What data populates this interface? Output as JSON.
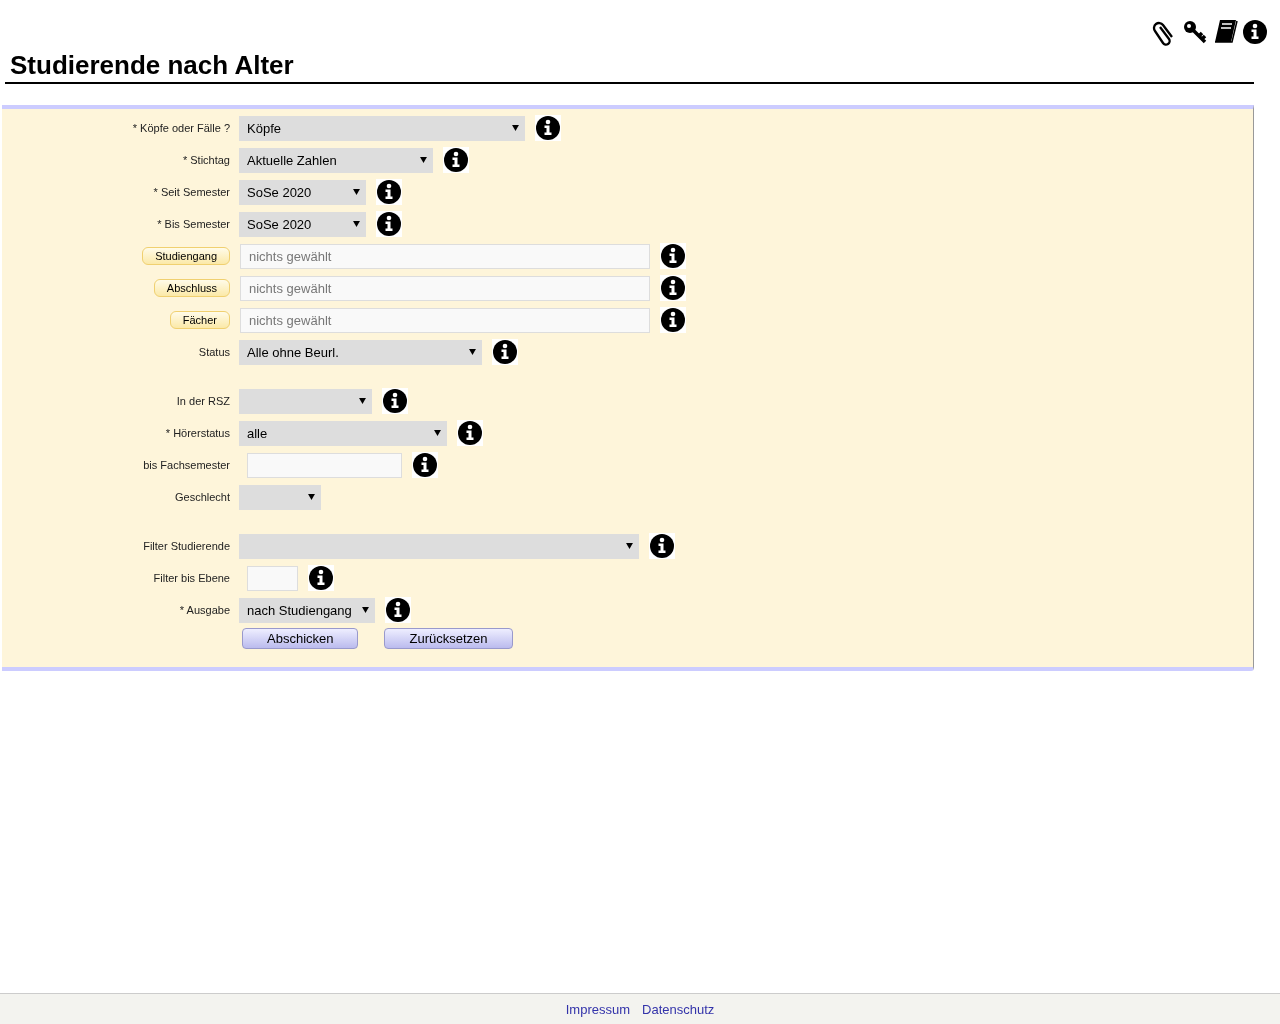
{
  "title": "Studierende nach Alter",
  "field_groups": [
    [
      {
        "kind": "select",
        "label": "* Köpfe oder Fälle ?",
        "value": "Köpfe",
        "info_icon": true
      },
      {
        "kind": "select",
        "label": "* Stichtag",
        "value": "Aktuelle Zahlen",
        "info_icon": true
      },
      {
        "kind": "select",
        "label": "* Seit Semester",
        "value": "SoSe 2020",
        "info_icon": true
      },
      {
        "kind": "select",
        "label": "* Bis Semester",
        "value": "SoSe 2020",
        "info_icon": true
      },
      {
        "kind": "picker",
        "label": "Studiengang",
        "placeholder": "nichts gewählt",
        "info_icon": true
      },
      {
        "kind": "picker",
        "label": "Abschluss",
        "placeholder": "nichts gewählt",
        "info_icon": true
      },
      {
        "kind": "picker",
        "label": "Fächer",
        "placeholder": "nichts gewählt",
        "info_icon": true
      },
      {
        "kind": "select",
        "label": "Status",
        "value": "Alle ohne Beurl.",
        "info_icon": true
      }
    ],
    [
      {
        "kind": "select",
        "label": "In der RSZ",
        "info_icon": true
      },
      {
        "kind": "select",
        "label": "* Hörerstatus",
        "value": "alle",
        "info_icon": true
      },
      {
        "kind": "input",
        "label": "bis Fachsemester",
        "info_icon": true
      },
      {
        "kind": "select",
        "label": "Geschlecht",
        "info_icon": false
      }
    ],
    [
      {
        "kind": "select",
        "label": "Filter Studierende",
        "info_icon": true
      },
      {
        "kind": "input",
        "label": "Filter bis Ebene",
        "info_icon": true
      },
      {
        "kind": "select",
        "label": "* Ausgabe",
        "value": "nach Studiengang",
        "info_icon": true
      }
    ]
  ],
  "buttons": [
    "Abschicken",
    "Zurücksetzen"
  ],
  "footer_links": [
    "Impressum",
    "Datenschutz"
  ]
}
